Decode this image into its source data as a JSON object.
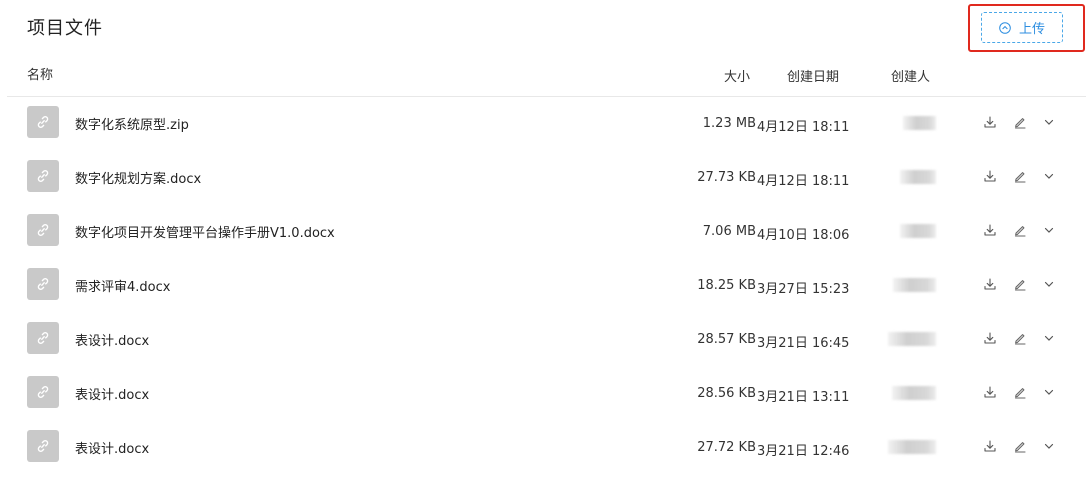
{
  "page": {
    "title": "项目文件"
  },
  "toolbar": {
    "upload_label": "上传",
    "upload_icon": "upload-circle-icon"
  },
  "columns": {
    "name": "名称",
    "size": "大小",
    "date": "创建日期",
    "creator": "创建人"
  },
  "files": [
    {
      "name": "数字化系统原型.zip",
      "size": "1.23 MB",
      "date": "4月12日 18:11"
    },
    {
      "name": "数字化规划方案.docx",
      "size": "27.73 KB",
      "date": "4月12日 18:11"
    },
    {
      "name": "数字化项目开发管理平台操作手册V1.0.docx",
      "size": "7.06 MB",
      "date": "4月10日 18:06"
    },
    {
      "name": "需求评审4.docx",
      "size": "18.25 KB",
      "date": "3月27日 15:23"
    },
    {
      "name": "表设计.docx",
      "size": "28.57 KB",
      "date": "3月21日 16:45"
    },
    {
      "name": "表设计.docx",
      "size": "28.56 KB",
      "date": "3月21日 13:11"
    },
    {
      "name": "表设计.docx",
      "size": "27.72 KB",
      "date": "3月21日 12:46"
    }
  ],
  "icons": {
    "file": "link-icon",
    "download": "download-icon",
    "edit": "edit-icon",
    "expand": "chevron-down-icon"
  },
  "colors": {
    "accent": "#2d8ee0",
    "highlight": "#e0291e",
    "file_icon_bg": "#c9c9c9"
  }
}
